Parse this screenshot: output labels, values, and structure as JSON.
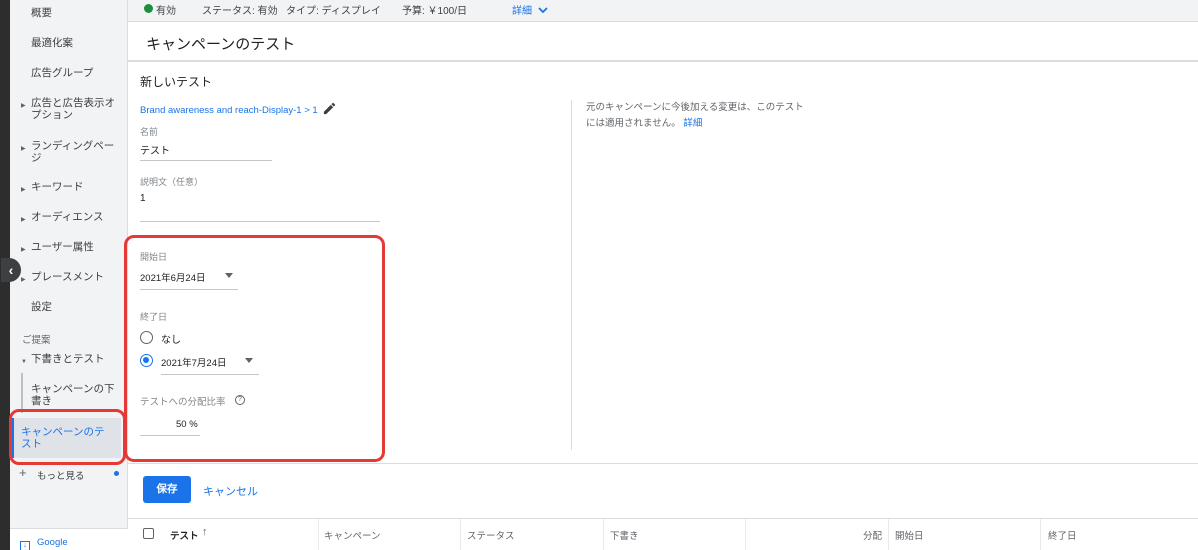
{
  "sidebar": {
    "items": [
      {
        "label": "概要"
      },
      {
        "label": "最適化案"
      },
      {
        "label": "広告グループ"
      },
      {
        "label": "広告と広告表示オプション"
      },
      {
        "label": "ランディングページ"
      },
      {
        "label": "キーワード"
      },
      {
        "label": "オーディエンス"
      },
      {
        "label": "ユーザー属性"
      },
      {
        "label": "プレースメント"
      },
      {
        "label": "設定"
      }
    ],
    "section_label": "ご提案",
    "drafts_label": "下書きとテスト",
    "drafts_sub": "キャンペーンの下書き",
    "active_label": "キャンペーンのテスト",
    "more_label": "もっと見る",
    "google_label": "Google"
  },
  "status_bar": {
    "status_enabled": "有効",
    "status_label": "ステータス: 有効",
    "type_label": "タイプ: ディスプレイ",
    "budget_label": "予算: ￥100/日",
    "details_link": "詳細"
  },
  "header": {
    "title": "キャンペーンのテスト"
  },
  "form": {
    "card_title": "新しいテスト",
    "campaign_link": "Brand awareness and reach-Display-1 > 1",
    "name_label": "名前",
    "name_value": "テスト",
    "description_label": "説明文（任意）",
    "description_value": "1",
    "start_date_label": "開始日",
    "start_date_value": "2021年6月24日",
    "end_date_label": "終了日",
    "end_none_label": "なし",
    "end_date_value": "2021年7月24日",
    "split_label": "テストへの分配比率",
    "split_value": "50 %"
  },
  "notice": {
    "text": "元のキャンペーンに今後加える変更は、このテストには適用されません。",
    "link": "詳細"
  },
  "actions": {
    "save": "保存",
    "cancel": "キャンセル"
  },
  "table": {
    "headers": [
      "テスト",
      "キャンペーン",
      "ステータス",
      "下書き",
      "分配",
      "開始日",
      "終了日"
    ],
    "sort_icon": "↑"
  },
  "colors": {
    "accent": "#1a73e8",
    "highlight": "#e53935",
    "status_green": "#1e8e3e"
  }
}
